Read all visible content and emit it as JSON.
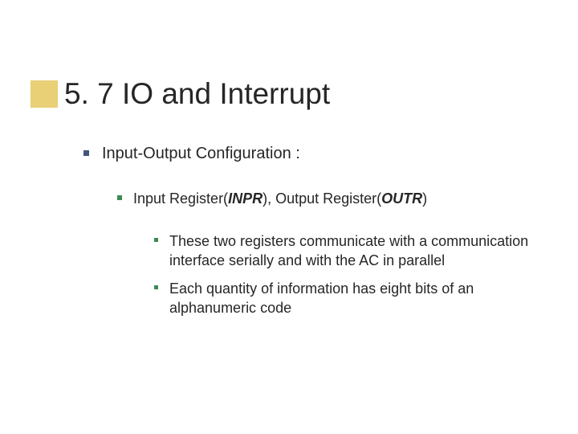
{
  "title": "5. 7 IO and Interrupt",
  "lvl1": {
    "text": "Input-Output Configuration :"
  },
  "lvl2": {
    "pre": "Input Register(",
    "r1": "INPR",
    "mid": "), Output Register(",
    "r2": "OUTR",
    "post": ")"
  },
  "lvl3a": "These two registers communicate with a communication interface serially and with the AC in parallel",
  "lvl3b": "Each quantity of information has eight bits of an alphanumeric code"
}
